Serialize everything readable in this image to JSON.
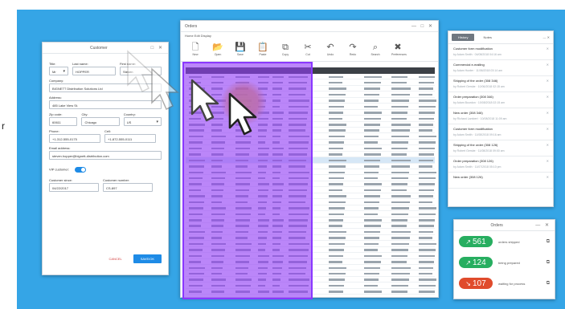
{
  "edge_text": "r",
  "customer_window": {
    "title": "Customer",
    "controls": "□ ✕",
    "title_label": "Title:",
    "title_value": "Mr",
    "last_name_label": "Last name:",
    "last_name_value": "HOPPER",
    "first_name_label": "First name:",
    "first_name_value": "Steven",
    "company_label": "Company:",
    "company_value": "BIGNETT Distribution Solutions Ltd",
    "address_label": "Address:",
    "address_value": "485 Lake View St.",
    "zip_label": "Zip code:",
    "zip_value": "60611",
    "city_label": "City:",
    "city_value": "Chicago",
    "country_label": "Country:",
    "country_value": "US",
    "phone_label": "Phone:",
    "phone_value": "+1-312-555-0175",
    "cell_label": "Cell:",
    "cell_value": "+1-872-555-0111",
    "email_label": "Email address:",
    "email_value": "steven.hopper@bignett-distribution.com",
    "vip_label": "VIP customer:",
    "since_label": "Customer since:",
    "since_value": "04/22/2017",
    "number_label": "Customer number:",
    "number_value": "CS-897",
    "cancel_label": "CANCEL",
    "save_label": "SAVE/OK"
  },
  "orders_window": {
    "title": "Orders",
    "controls": "—  □  ✕",
    "menu": "Home  Edit  Display",
    "ribbon": [
      {
        "icon": "new-icon",
        "glyph": "🗋",
        "label": "New"
      },
      {
        "icon": "open-icon",
        "glyph": "📂",
        "label": "Open"
      },
      {
        "icon": "save-icon",
        "glyph": "💾",
        "label": "Save"
      },
      {
        "icon": "paste-icon",
        "glyph": "📋",
        "label": "Paste"
      },
      {
        "icon": "copy-icon",
        "glyph": "⧉",
        "label": "Copy"
      },
      {
        "icon": "cut-icon",
        "glyph": "✂",
        "label": "Cut"
      },
      {
        "icon": "undo-icon",
        "glyph": "↶",
        "label": "Undo"
      },
      {
        "icon": "redo-icon",
        "glyph": "↷",
        "label": "Redo"
      },
      {
        "icon": "search-icon",
        "glyph": "⌕",
        "label": "Search"
      },
      {
        "icon": "tools-icon",
        "glyph": "✖",
        "label": "Preferences"
      }
    ]
  },
  "history_window": {
    "tab_history": "History",
    "tab_notes": "Notes",
    "controls": "— ✕",
    "items": [
      {
        "title": "Customer form modification",
        "sub": "by Adam Smith  ·  04/08/2018 04:16 am"
      },
      {
        "title": "Commercial e-mailing",
        "sub": "by Adam Hunter  ·  11/06/2018 03:14 am"
      },
      {
        "title": "Shipping of the order (308 346)",
        "sub": "by Robert Gersbe  ·  10/06/2018 02:15 am"
      },
      {
        "title": "Order preparation (308 346)",
        "sub": "by Adam Bourdon  ·  10/08/2018 02:15 am"
      },
      {
        "title": "New order (308 346)",
        "sub": "by Richard Lambert  ·  10/08/2018 11:09 am"
      },
      {
        "title": "Customer form modification",
        "sub": "by Adam Smith  ·  11/08/2018 09:16 am"
      },
      {
        "title": "Shipping of the order (308 126)",
        "sub": "by Robert Gersbe  ·  11/08/2018 09:00 am"
      },
      {
        "title": "Order preparation (308 126)",
        "sub": "by Adam Smith  ·  11/07/2018 05:10 pm"
      },
      {
        "title": "New order (308 126)",
        "sub": ""
      }
    ]
  },
  "summary_window": {
    "title": "Orders",
    "controls": "— ✕",
    "rows": [
      {
        "value": "561",
        "arrow": "↗",
        "label": "orders shipped",
        "color": "#27ae60"
      },
      {
        "value": "124",
        "arrow": "↗",
        "label": "being prepared",
        "color": "#27ae60"
      },
      {
        "value": "107",
        "arrow": "↘",
        "label": "waiting for process",
        "color": "#e04b2c"
      }
    ]
  },
  "colors": {
    "background": "#35a5e6",
    "overlay": "#8a37ff",
    "accent": "#1e8be6"
  }
}
